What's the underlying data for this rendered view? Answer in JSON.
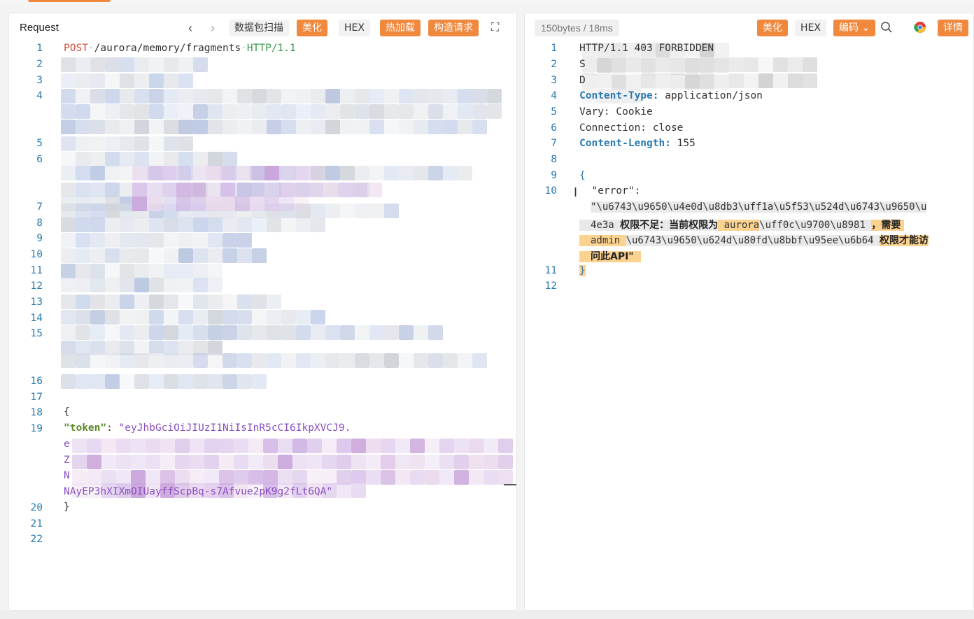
{
  "request": {
    "title": "Request",
    "buttons": {
      "scan": "数据包扫描",
      "beautify": "美化",
      "hex": "HEX",
      "hot_load": "热加载",
      "construct": "构造请求"
    },
    "line_numbers": [
      "1",
      "2",
      "3",
      "4",
      "5",
      "6",
      "7",
      "8",
      "9",
      "10",
      "11",
      "12",
      "13",
      "14",
      "15",
      "16",
      "17",
      "18",
      "19",
      "20",
      "21",
      "22"
    ],
    "line1": {
      "method": "POST",
      "path": "/aurora/memory/fragments",
      "version": "HTTP/1.1"
    },
    "body_open": "{",
    "token_key": "\"token\"",
    "token_colon": ": ",
    "token_start": "\"eyJhbGciOiJIUzI1NiIsInR5cCI6IkpXVCJ9.",
    "token_l2": "e",
    "token_l3": "Z",
    "token_l4": "N",
    "token_end": "NAyEP3hXIXmOIUayffScpBq-s7Afvue2pK9g2fLt6QA\"",
    "body_close": "}"
  },
  "response": {
    "status": "150bytes / 18ms",
    "buttons": {
      "beautify": "美化",
      "hex": "HEX",
      "encoding": "编码",
      "details": "详情"
    },
    "line_numbers": [
      "1",
      "2",
      "3",
      "4",
      "5",
      "6",
      "7",
      "8",
      "9",
      "10",
      "11",
      "12"
    ],
    "line1": "HTTP/1.1 403 FORBIDDEN",
    "line2_start": "S",
    "line3_start": "D",
    "ct_key": "Content-Type:",
    "ct_val": " application/json",
    "vary": "Vary: Cookie",
    "conn": "Connection: close",
    "cl_key": "Content-Length:",
    "cl_val": " 155",
    "brace_open": "{",
    "error_key": "  \"error\": ",
    "err_l1": "\"\\u6743\\u9650\\u4e0d\\u8db3\\uff1a\\u5f53\\u524d\\u6743\\u9650\\u",
    "err_l2a": "4e3a ",
    "err_l2b": "权限不足：当前权限为",
    "err_l2c": " aurora",
    "err_l2d": "\\uff0c\\u9700\\u8981 ",
    "err_l2e": "，需要 ",
    "err_l3a": "admin ",
    "err_l3b": "\\u6743\\u9650\\u624d\\u80fd\\u8bbf\\u95ee\\u6b64 ",
    "err_l3c": "权限才能访",
    "err_l4": "问此API\"",
    "brace_close": "}"
  }
}
